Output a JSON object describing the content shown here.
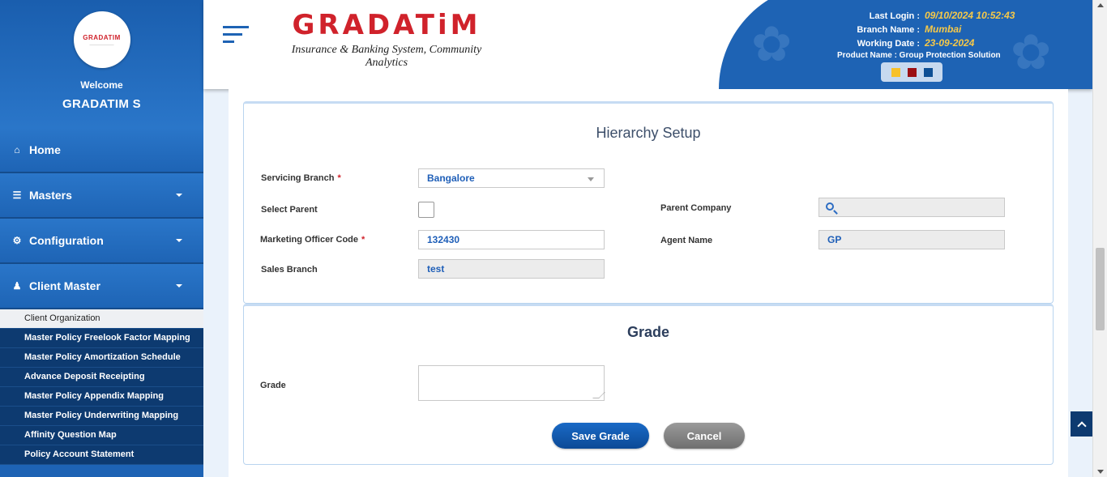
{
  "sidebar": {
    "welcome": "Welcome",
    "username": "GRADATIM S",
    "avatar_logo": "GRADATIM",
    "menu": [
      {
        "label": "Home",
        "icon": "home-icon"
      },
      {
        "label": "Masters",
        "icon": "database-icon"
      },
      {
        "label": "Configuration",
        "icon": "gears-icon"
      },
      {
        "label": "Client Master",
        "icon": "user-icon"
      }
    ],
    "submenu": [
      "Client Organization",
      "Master Policy Freelook Factor Mapping",
      "Master Policy Amortization Schedule",
      "Advance Deposit Receipting",
      "Master Policy Appendix Mapping",
      "Master Policy Underwriting Mapping",
      "Affinity Question Map",
      "Policy Account Statement"
    ]
  },
  "header": {
    "brand": "GRADATiM",
    "tagline": "Insurance & Banking System, Community Analytics",
    "last_login_label": "Last Login :",
    "last_login": "09/10/2024 10:52:43",
    "branch_name_label": "Branch Name :",
    "branch_name": "Mumbai",
    "working_date_label": "Working Date :",
    "working_date": "23-09-2024",
    "product_name": "Product Name : Group Protection Solution",
    "theme_colors": [
      "#f7c12a",
      "#9b0f14",
      "#0e4f94"
    ]
  },
  "hierarchy": {
    "title": "Hierarchy Setup",
    "servicing_branch_label": "Servicing Branch",
    "servicing_branch": "Bangalore",
    "select_parent_label": "Select Parent",
    "parent_company_label": "Parent Company",
    "parent_company": "",
    "marketing_officer_label": "Marketing Officer Code",
    "marketing_officer": "132430",
    "agent_name_label": "Agent Name",
    "agent_name": "GP",
    "sales_branch_label": "Sales Branch",
    "sales_branch": "test",
    "required_mark": "*"
  },
  "grade": {
    "title": "Grade",
    "grade_label": "Grade",
    "grade_value": "",
    "save_label": "Save Grade",
    "cancel_label": "Cancel"
  }
}
